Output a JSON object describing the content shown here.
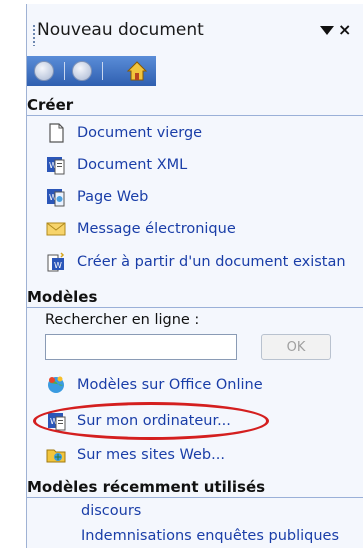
{
  "pane": {
    "title": "Nouveau document"
  },
  "nav": {
    "back_icon": "back-arrow-icon",
    "forward_icon": "forward-arrow-icon",
    "home_icon": "home-icon"
  },
  "creer": {
    "heading": "Créer",
    "items": [
      {
        "label": "Document vierge",
        "icon": "blank-document-icon"
      },
      {
        "label": "Document XML",
        "icon": "xml-document-icon"
      },
      {
        "label": "Page Web",
        "icon": "web-page-icon"
      },
      {
        "label": "Message électronique",
        "icon": "envelope-icon"
      },
      {
        "label": "Créer à partir d'un document existan",
        "icon": "existing-document-icon"
      }
    ]
  },
  "modeles": {
    "heading": "Modèles",
    "search_label": "Rechercher en ligne :",
    "search_value": "",
    "ok_label": "OK",
    "items": [
      {
        "label": "Modèles sur Office Online",
        "icon": "office-online-icon"
      },
      {
        "label": "Sur mon ordinateur...",
        "icon": "word-template-icon"
      },
      {
        "label": "Sur mes sites Web...",
        "icon": "web-sites-folder-icon"
      }
    ],
    "highlight_color": "#d41f1f"
  },
  "recent": {
    "heading": "Modèles récemment utilisés",
    "items": [
      {
        "label": "discours"
      },
      {
        "label": "Indemnisations enquêtes publiques"
      }
    ]
  },
  "colors": {
    "link": "#1a3ea8",
    "nav_bar": "#3a6cc0",
    "pane_bg": "#f4f7fd"
  }
}
